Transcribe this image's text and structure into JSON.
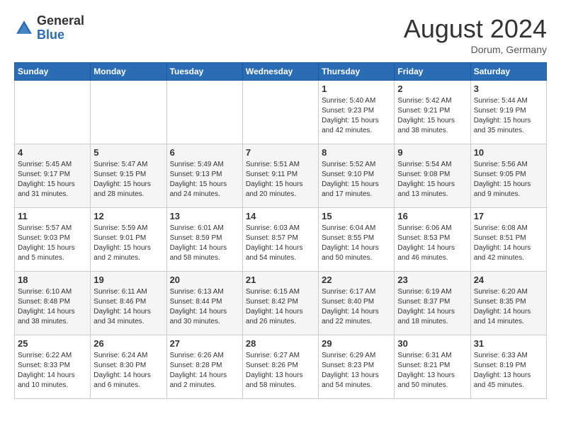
{
  "header": {
    "logo": {
      "general": "General",
      "blue": "Blue"
    },
    "month": "August 2024",
    "location": "Dorum, Germany"
  },
  "weekdays": [
    "Sunday",
    "Monday",
    "Tuesday",
    "Wednesday",
    "Thursday",
    "Friday",
    "Saturday"
  ],
  "weeks": [
    [
      {
        "day": "",
        "info": ""
      },
      {
        "day": "",
        "info": ""
      },
      {
        "day": "",
        "info": ""
      },
      {
        "day": "",
        "info": ""
      },
      {
        "day": "1",
        "info": "Sunrise: 5:40 AM\nSunset: 9:23 PM\nDaylight: 15 hours\nand 42 minutes."
      },
      {
        "day": "2",
        "info": "Sunrise: 5:42 AM\nSunset: 9:21 PM\nDaylight: 15 hours\nand 38 minutes."
      },
      {
        "day": "3",
        "info": "Sunrise: 5:44 AM\nSunset: 9:19 PM\nDaylight: 15 hours\nand 35 minutes."
      }
    ],
    [
      {
        "day": "4",
        "info": "Sunrise: 5:45 AM\nSunset: 9:17 PM\nDaylight: 15 hours\nand 31 minutes."
      },
      {
        "day": "5",
        "info": "Sunrise: 5:47 AM\nSunset: 9:15 PM\nDaylight: 15 hours\nand 28 minutes."
      },
      {
        "day": "6",
        "info": "Sunrise: 5:49 AM\nSunset: 9:13 PM\nDaylight: 15 hours\nand 24 minutes."
      },
      {
        "day": "7",
        "info": "Sunrise: 5:51 AM\nSunset: 9:11 PM\nDaylight: 15 hours\nand 20 minutes."
      },
      {
        "day": "8",
        "info": "Sunrise: 5:52 AM\nSunset: 9:10 PM\nDaylight: 15 hours\nand 17 minutes."
      },
      {
        "day": "9",
        "info": "Sunrise: 5:54 AM\nSunset: 9:08 PM\nDaylight: 15 hours\nand 13 minutes."
      },
      {
        "day": "10",
        "info": "Sunrise: 5:56 AM\nSunset: 9:05 PM\nDaylight: 15 hours\nand 9 minutes."
      }
    ],
    [
      {
        "day": "11",
        "info": "Sunrise: 5:57 AM\nSunset: 9:03 PM\nDaylight: 15 hours\nand 5 minutes."
      },
      {
        "day": "12",
        "info": "Sunrise: 5:59 AM\nSunset: 9:01 PM\nDaylight: 15 hours\nand 2 minutes."
      },
      {
        "day": "13",
        "info": "Sunrise: 6:01 AM\nSunset: 8:59 PM\nDaylight: 14 hours\nand 58 minutes."
      },
      {
        "day": "14",
        "info": "Sunrise: 6:03 AM\nSunset: 8:57 PM\nDaylight: 14 hours\nand 54 minutes."
      },
      {
        "day": "15",
        "info": "Sunrise: 6:04 AM\nSunset: 8:55 PM\nDaylight: 14 hours\nand 50 minutes."
      },
      {
        "day": "16",
        "info": "Sunrise: 6:06 AM\nSunset: 8:53 PM\nDaylight: 14 hours\nand 46 minutes."
      },
      {
        "day": "17",
        "info": "Sunrise: 6:08 AM\nSunset: 8:51 PM\nDaylight: 14 hours\nand 42 minutes."
      }
    ],
    [
      {
        "day": "18",
        "info": "Sunrise: 6:10 AM\nSunset: 8:48 PM\nDaylight: 14 hours\nand 38 minutes."
      },
      {
        "day": "19",
        "info": "Sunrise: 6:11 AM\nSunset: 8:46 PM\nDaylight: 14 hours\nand 34 minutes."
      },
      {
        "day": "20",
        "info": "Sunrise: 6:13 AM\nSunset: 8:44 PM\nDaylight: 14 hours\nand 30 minutes."
      },
      {
        "day": "21",
        "info": "Sunrise: 6:15 AM\nSunset: 8:42 PM\nDaylight: 14 hours\nand 26 minutes."
      },
      {
        "day": "22",
        "info": "Sunrise: 6:17 AM\nSunset: 8:40 PM\nDaylight: 14 hours\nand 22 minutes."
      },
      {
        "day": "23",
        "info": "Sunrise: 6:19 AM\nSunset: 8:37 PM\nDaylight: 14 hours\nand 18 minutes."
      },
      {
        "day": "24",
        "info": "Sunrise: 6:20 AM\nSunset: 8:35 PM\nDaylight: 14 hours\nand 14 minutes."
      }
    ],
    [
      {
        "day": "25",
        "info": "Sunrise: 6:22 AM\nSunset: 8:33 PM\nDaylight: 14 hours\nand 10 minutes."
      },
      {
        "day": "26",
        "info": "Sunrise: 6:24 AM\nSunset: 8:30 PM\nDaylight: 14 hours\nand 6 minutes."
      },
      {
        "day": "27",
        "info": "Sunrise: 6:26 AM\nSunset: 8:28 PM\nDaylight: 14 hours\nand 2 minutes."
      },
      {
        "day": "28",
        "info": "Sunrise: 6:27 AM\nSunset: 8:26 PM\nDaylight: 13 hours\nand 58 minutes."
      },
      {
        "day": "29",
        "info": "Sunrise: 6:29 AM\nSunset: 8:23 PM\nDaylight: 13 hours\nand 54 minutes."
      },
      {
        "day": "30",
        "info": "Sunrise: 6:31 AM\nSunset: 8:21 PM\nDaylight: 13 hours\nand 50 minutes."
      },
      {
        "day": "31",
        "info": "Sunrise: 6:33 AM\nSunset: 8:19 PM\nDaylight: 13 hours\nand 45 minutes."
      }
    ]
  ]
}
